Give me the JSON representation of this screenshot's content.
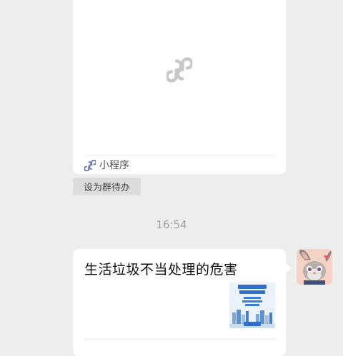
{
  "mini_program_card": {
    "footer_label": "小程序",
    "placeholder_icon": "mini-program-link-icon",
    "footer_icon": "mini-program-icon"
  },
  "todo_button_label": "设为群待办",
  "timestamp": "16:54",
  "link_message": {
    "title": "生活垃圾不当处理的危害",
    "thumbnail": "article-thumbnail-image"
  },
  "avatar": {
    "icon": "bunny-avatar-image"
  },
  "colors": {
    "background": "#ededed",
    "card": "#ffffff",
    "pill": "#dcdcdc",
    "mini_program_accent": "#5a6bb8"
  }
}
